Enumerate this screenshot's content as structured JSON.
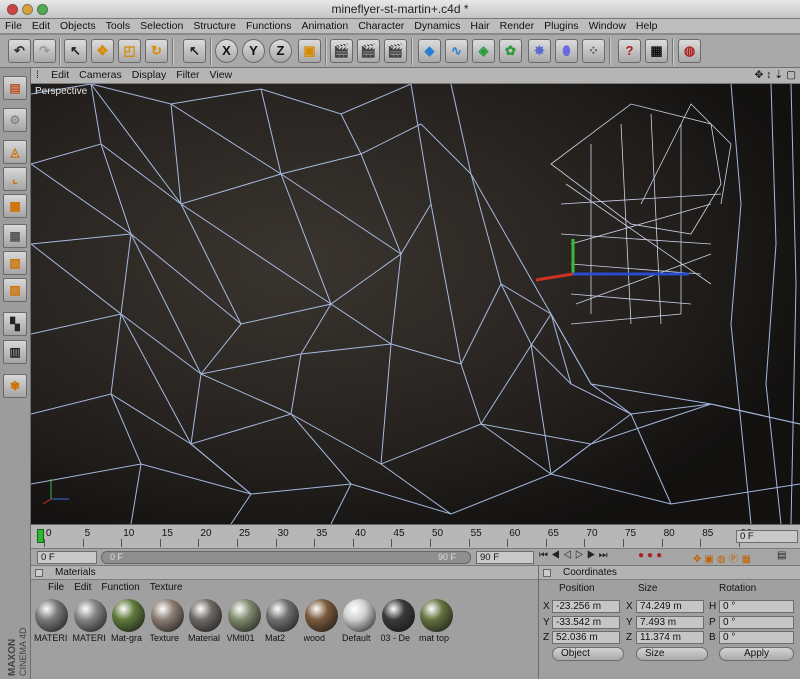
{
  "window": {
    "title": "mineflyer-st-martin+.c4d *"
  },
  "menu": [
    "File",
    "Edit",
    "Objects",
    "Tools",
    "Selection",
    "Structure",
    "Functions",
    "Animation",
    "Character",
    "Dynamics",
    "Hair",
    "Render",
    "Plugins",
    "Window",
    "Help"
  ],
  "toolbar": {
    "x_label": "X",
    "y_label": "Y",
    "z_label": "Z"
  },
  "viewport": {
    "menu": [
      "Edit",
      "Cameras",
      "Display",
      "Filter",
      "View"
    ],
    "camera_label": "Perspective"
  },
  "timeline": {
    "ticks": [
      "0",
      "5",
      "10",
      "15",
      "20",
      "25",
      "30",
      "35",
      "40",
      "45",
      "50",
      "55",
      "60",
      "65",
      "70",
      "75",
      "80",
      "85",
      "90"
    ],
    "current_frame": "0 F",
    "start_frame": "0 F",
    "range_start": "0 F",
    "range_end": "90 F",
    "end_frame": "90 F"
  },
  "materials": {
    "title": "Materials",
    "menu": [
      "File",
      "Edit",
      "Function",
      "Texture"
    ],
    "items": [
      {
        "name": "MATERI",
        "color": "#7a7a7a"
      },
      {
        "name": "MATERI",
        "color": "#858585"
      },
      {
        "name": "Mat-gra",
        "color": "#5f7a3a"
      },
      {
        "name": "Texture",
        "color": "#8c7e74"
      },
      {
        "name": "Material",
        "color": "#6e6a66"
      },
      {
        "name": "VMtl01",
        "color": "#7f8a6e"
      },
      {
        "name": "Mat2",
        "color": "#707070"
      },
      {
        "name": "wood",
        "color": "#7a5a3c"
      },
      {
        "name": "Default",
        "color": "#d0d0d0"
      },
      {
        "name": "03 - De",
        "color": "#3a3a3a"
      },
      {
        "name": "mat top",
        "color": "#65733f"
      }
    ]
  },
  "coordinates": {
    "title": "Coordinates",
    "headers": {
      "position": "Position",
      "size": "Size",
      "rotation": "Rotation"
    },
    "rows": [
      {
        "axis": "X",
        "position": "-23.256 m",
        "size_axis": "X",
        "size": "74.249 m",
        "rot_axis": "H",
        "rotation": "0 °"
      },
      {
        "axis": "Y",
        "position": "-33.542 m",
        "size_axis": "Y",
        "size": "7.493 m",
        "rot_axis": "P",
        "rotation": "0 °"
      },
      {
        "axis": "Z",
        "position": "52.036 m",
        "size_axis": "Z",
        "size": "11.374 m",
        "rot_axis": "B",
        "rotation": "0 °"
      }
    ],
    "mode_select": "Object",
    "size_select": "Size",
    "apply_label": "Apply"
  },
  "branding": {
    "line1": "MAXON",
    "line2": "CINEMA 4D"
  }
}
